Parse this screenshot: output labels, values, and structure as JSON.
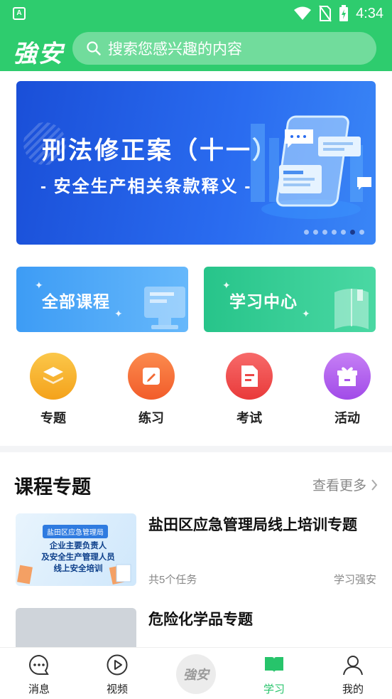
{
  "status_bar": {
    "time": "4:34"
  },
  "header": {
    "logo_text": "強安",
    "search_placeholder": "搜索您感兴趣的内容"
  },
  "banner": {
    "title": "刑法修正案（十一）",
    "subtitle": "- 安全生产相关条款释义 -",
    "dot_count": 7,
    "active_dot": 5
  },
  "cards": [
    {
      "label": "全部课程"
    },
    {
      "label": "学习中心"
    }
  ],
  "shortcuts": [
    {
      "label": "专题",
      "icon": "layers-icon",
      "color": "#f6b024"
    },
    {
      "label": "练习",
      "icon": "pencil-icon",
      "color": "#f5703a"
    },
    {
      "label": "考试",
      "icon": "document-icon",
      "color": "#f04747"
    },
    {
      "label": "活动",
      "icon": "gift-icon",
      "color": "#b35ef0"
    }
  ],
  "section": {
    "title": "课程专题",
    "more_label": "查看更多"
  },
  "courses": [
    {
      "title": "盐田区应急管理局线上培训专题",
      "tasks": "共5个任务",
      "source": "学习强安",
      "thumb_tag": "盐田区应急管理局",
      "thumb_text": "企业主要负责人\n及安全生产管理人员\n线上安全培训"
    },
    {
      "title": "危险化学品专题"
    }
  ],
  "bottom_nav": {
    "items": [
      {
        "label": "消息",
        "icon": "chat-icon"
      },
      {
        "label": "视频",
        "icon": "play-icon"
      },
      {
        "label": "学习",
        "icon": "book-icon",
        "active": true
      },
      {
        "label": "我的",
        "icon": "user-icon"
      }
    ],
    "center_logo": "強安"
  },
  "colors": {
    "brand_green": "#2ecc6e",
    "active_tab": "#27c46b"
  }
}
